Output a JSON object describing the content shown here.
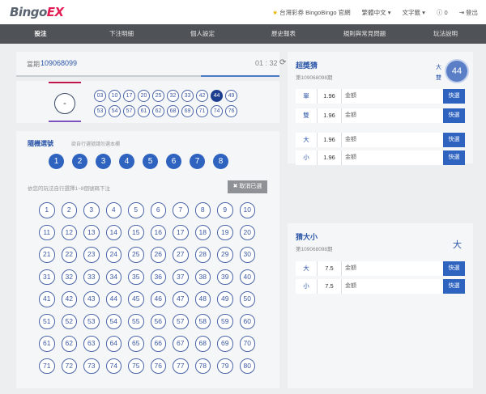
{
  "header": {
    "logo_main": "Bingo",
    "logo_accent": "EX",
    "official_link": "台灣彩券 BingoBingo 官網",
    "lang": "繁體中文",
    "font_size": "文字籤",
    "coins": "0",
    "logout": "登出"
  },
  "nav": [
    "投注",
    "下注明細",
    "個人設定",
    "歷史報表",
    "規則與常見問題",
    "玩法說明"
  ],
  "draw": {
    "label": "當期",
    "number": "109068099",
    "timer": "01 : 32",
    "progress": 0.3
  },
  "result": {
    "super_number": "-",
    "balls": [
      "03",
      "10",
      "17",
      "20",
      "25",
      "32",
      "33",
      "42",
      "44",
      "49",
      "53",
      "54",
      "57",
      "61",
      "62",
      "68",
      "69",
      "71",
      "74",
      "76"
    ],
    "highlight": "44"
  },
  "picker": {
    "title": "隨機選號",
    "hint": "欲自行選號請勿選本欄",
    "quick": [
      "1",
      "2",
      "3",
      "4",
      "5",
      "6",
      "7",
      "8"
    ],
    "hint2": "依您的玩法自行選擇1~8個號碼下注",
    "cancel": "✖ 取消已選",
    "numbers": [
      "1",
      "2",
      "3",
      "4",
      "5",
      "6",
      "7",
      "8",
      "9",
      "10",
      "11",
      "12",
      "13",
      "14",
      "15",
      "16",
      "17",
      "18",
      "19",
      "20",
      "21",
      "22",
      "23",
      "24",
      "25",
      "26",
      "27",
      "28",
      "29",
      "30",
      "31",
      "32",
      "33",
      "34",
      "35",
      "36",
      "37",
      "38",
      "39",
      "40",
      "41",
      "42",
      "43",
      "44",
      "45",
      "46",
      "47",
      "48",
      "49",
      "50",
      "51",
      "52",
      "53",
      "54",
      "55",
      "56",
      "57",
      "58",
      "59",
      "60",
      "61",
      "62",
      "63",
      "64",
      "65",
      "66",
      "67",
      "68",
      "69",
      "70",
      "71",
      "72",
      "73",
      "74",
      "75",
      "76",
      "77",
      "78",
      "79",
      "80"
    ]
  },
  "super": {
    "title": "超獎猜",
    "sub": "第109068098期",
    "tag1": "大",
    "tag2": "雙",
    "ball": "44",
    "rows": [
      {
        "k": "單",
        "o": "1.96",
        "m": "金額",
        "b": "快選"
      },
      {
        "k": "雙",
        "o": "1.96",
        "m": "金額",
        "b": "快選"
      },
      {
        "k": "大",
        "o": "1.96",
        "m": "金額",
        "b": "快選"
      },
      {
        "k": "小",
        "o": "1.96",
        "m": "金額",
        "b": "快選"
      }
    ]
  },
  "bigsmall": {
    "title": "猜大小",
    "sub": "第109068098期",
    "tag": "大",
    "rows": [
      {
        "k": "大",
        "o": "7.5",
        "m": "金額",
        "b": "快選"
      },
      {
        "k": "小",
        "o": "7.5",
        "m": "金額",
        "b": "快選"
      }
    ]
  }
}
